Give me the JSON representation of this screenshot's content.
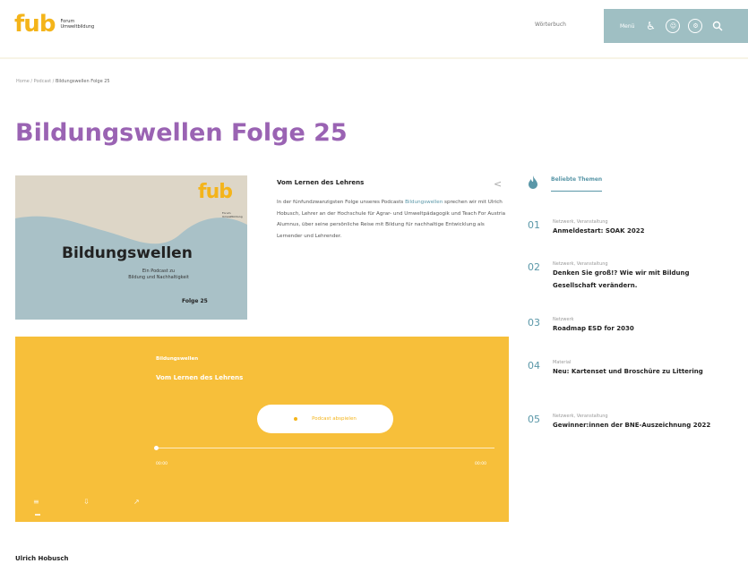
{
  "header": {
    "logo_mark": "fub",
    "logo_line1": "Forum",
    "logo_line2": "Umweltbildung",
    "woerterbuch": "Wörterbuch",
    "menu_label": "Menü",
    "accessibility_icon": "accessibility-icon",
    "easy_read_icon": "easy-language-icon",
    "settings_icon": "settings-icon",
    "search_icon": "search-icon"
  },
  "breadcrumb": {
    "home": "Home",
    "sep1": " / ",
    "podcast": "Podcast",
    "sep2": " / ",
    "current": "Bildungswellen Folge 25"
  },
  "page_title": "Bildungswellen Folge 25",
  "cover": {
    "logo": "fub",
    "logo_sub1": "Forum",
    "logo_sub2": "Umweltbildung",
    "title": "Bildungswellen",
    "subtitle1": "Ein Podcast zu",
    "subtitle2": "Bildung und Nachhaltigkeit",
    "episode": "Folge 25"
  },
  "description": {
    "heading": "Vom Lernen des Lehrens",
    "text_before_link": "In der fünfundzwanzigsten Folge unseres Podcasts ",
    "link": "Bildungswellen",
    "text_after_link": " sprechen wir mit Ulrich Hobusch, Lehrer an der Hochschule für Agrar- und Umweltpädagogik und Teach For Austria Alumnus, über seine persönliche Reise mit Bildung für nachhaltige Entwicklung als Lernender und Lehrender."
  },
  "player": {
    "series": "Bildungswellen",
    "episode_title": "Vom Lernen des Lehrens",
    "play_label": "Podcast abspielen",
    "time_start": "00:00",
    "time_end": "00:00",
    "progress": 0
  },
  "sidebar": {
    "heading": "Beliebte Themen",
    "topics": [
      {
        "num": "01",
        "category": "Netzwerk, Veranstaltung",
        "title": "Anmeldestart: SOAK 2022"
      },
      {
        "num": "02",
        "category": "Netzwerk, Veranstaltung",
        "title": "Denken Sie groß!? Wie wir mit Bildung Gesellschaft verändern."
      },
      {
        "num": "03",
        "category": "Netzwerk",
        "title": "Roadmap ESD for 2030"
      },
      {
        "num": "04",
        "category": "Material",
        "title": "Neu: Kartenset und Broschüre zu Littering"
      },
      {
        "num": "05",
        "category": "Netzwerk, Veranstaltung",
        "title": "Gewinner:innen der BNE-Auszeichnung 2022"
      }
    ]
  },
  "author": {
    "name": "Ulrich Hobusch"
  },
  "colors": {
    "accent_purple": "#9a63b3",
    "player_yellow": "#f7bf3a",
    "teal": "#5a97a8",
    "nav_bg": "#9fbfc3",
    "logo_yellow": "#f4b41a"
  }
}
